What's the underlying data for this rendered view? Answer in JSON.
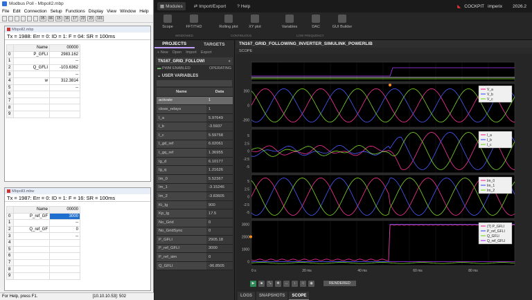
{
  "modbus": {
    "title": "Modbus Poll - Mbpoll2.mbp",
    "menu": [
      "File",
      "Edit",
      "Connection",
      "Setup",
      "Functions",
      "Display",
      "View",
      "Window",
      "Help"
    ],
    "toolbar": [
      "05",
      "06",
      "15",
      "16",
      "17",
      "22",
      "23",
      "101"
    ],
    "win1": {
      "title": "Mbpoll2.mbp",
      "status": "Tx = 1988: Err = 0: ID = 1: F = 04: SR = 100ms",
      "col_name": "Name",
      "col_value": "00000",
      "rows": [
        {
          "i": "0",
          "n": "P_GFLI",
          "v": "2983.162"
        },
        {
          "i": "1",
          "n": "",
          "v": "--"
        },
        {
          "i": "2",
          "n": "Q_GFLI",
          "v": "-103.6362"
        },
        {
          "i": "3",
          "n": "",
          "v": "--"
        },
        {
          "i": "4",
          "n": "w",
          "v": "312.3814"
        },
        {
          "i": "5",
          "n": "",
          "v": "--"
        },
        {
          "i": "6",
          "n": "",
          "v": ""
        },
        {
          "i": "7",
          "n": "",
          "v": ""
        },
        {
          "i": "8",
          "n": "",
          "v": ""
        },
        {
          "i": "9",
          "n": "",
          "v": ""
        }
      ]
    },
    "win2": {
      "title": "Mbpoll3.mbw",
      "status": "Tx = 1987: Err = 0: ID = 1: F = 16: SR = 100ms",
      "col_name": "Name",
      "col_value": "00000",
      "rows": [
        {
          "i": "0",
          "n": "P_ref_GF",
          "v": "3000"
        },
        {
          "i": "1",
          "n": "",
          "v": "--"
        },
        {
          "i": "2",
          "n": "Q_ref_GF",
          "v": "0"
        },
        {
          "i": "3",
          "n": "",
          "v": "--"
        },
        {
          "i": "4",
          "n": "",
          "v": ""
        },
        {
          "i": "5",
          "n": "",
          "v": ""
        },
        {
          "i": "6",
          "n": "",
          "v": ""
        },
        {
          "i": "7",
          "n": "",
          "v": ""
        },
        {
          "i": "8",
          "n": "",
          "v": ""
        },
        {
          "i": "9",
          "n": "",
          "v": ""
        }
      ]
    },
    "statusbar_left": "For Help, press F1.",
    "statusbar_right": "[10.10.10.53]: 502"
  },
  "cockpit": {
    "top_tabs": [
      "Modules",
      "Import/Export",
      "Help"
    ],
    "brand": "COCKPIT",
    "brand2": "imperix",
    "version": "2026.2",
    "ribbon": [
      "Scope",
      "FFT/THD",
      "Rolling plot",
      "XY plot",
      "Variables",
      "DAC",
      "GUI Builder"
    ],
    "ribbon_groups": [
      "WINDOWED",
      "CONTINUOUS",
      "LOW FREQUENCY"
    ],
    "left_tabs": [
      "PROJECTS",
      "TARGETS"
    ],
    "actions": [
      "+ New",
      "Open",
      "Import",
      "Export"
    ],
    "project_name": "TN167_GRID_FOLLOWI",
    "pwm_label": "PWM ENABLED",
    "pwm_status": "OPERATING",
    "user_vars_label": "USER VARIABLES",
    "col_name": "Name",
    "col_data": "Data",
    "variables": [
      {
        "n": "activate",
        "d": "1"
      },
      {
        "n": "close_relays",
        "d": "1"
      },
      {
        "n": "I_a",
        "d": "5.97649"
      },
      {
        "n": "I_b",
        "d": "-3.5937"
      },
      {
        "n": "I_c",
        "d": "5.59758"
      },
      {
        "n": "I_gd_ref",
        "d": "6.02061"
      },
      {
        "n": "I_gq_ref",
        "d": "1.36955"
      },
      {
        "n": "Ig_d",
        "d": "6.10177"
      },
      {
        "n": "Ig_q",
        "d": "1.21626"
      },
      {
        "n": "Im_0",
        "d": "5.52367"
      },
      {
        "n": "Im_1",
        "d": "-3.15246"
      },
      {
        "n": "Im_2",
        "d": "-3.83605"
      },
      {
        "n": "Ki_Ig",
        "d": "900"
      },
      {
        "n": "Kp_Ig",
        "d": "17.5"
      },
      {
        "n": "No_Grid",
        "d": "0"
      },
      {
        "n": "No_GridSync",
        "d": "0"
      },
      {
        "n": "P_GFLI",
        "d": "2905.18"
      },
      {
        "n": "P_ref_GFLI",
        "d": "3000"
      },
      {
        "n": "P_ref_sim",
        "d": "0"
      },
      {
        "n": "Q_GFLI",
        "d": "-96.8505"
      }
    ],
    "scope_title": "TN167_GRID_FOLLOWING_INVERTER_SIMULINK_POWERLIB",
    "scope_sub": "SCOPE",
    "rendered_label": "RENDERED",
    "bottom_tabs": [
      "LOGS",
      "SNAPSHOTS",
      "SCOPE"
    ],
    "colors": {
      "pink": "#ff3399",
      "blue": "#4a5cff",
      "green": "#7ddc2a",
      "purple": "#b23bff",
      "orange": "#ff8c1a"
    }
  },
  "chart_data": [
    {
      "type": "line",
      "series": [
        {
          "name": "",
          "values": [
            0,
            0,
            1,
            1
          ]
        }
      ]
    },
    {
      "type": "line",
      "ylabel": "",
      "ticks": [
        "200",
        "0",
        "-200"
      ],
      "ylim": [
        -300,
        300
      ],
      "series": [
        {
          "name": "V_a"
        },
        {
          "name": "V_b"
        },
        {
          "name": "V_c"
        }
      ],
      "amplitude": 230,
      "period_ms": 20
    },
    {
      "type": "line",
      "ticks": [
        "5",
        "2.5",
        "0",
        "-2.5",
        "-5"
      ],
      "ylim": [
        -7,
        7
      ],
      "series": [
        {
          "name": "I_a"
        },
        {
          "name": "I_b"
        },
        {
          "name": "I_c"
        }
      ],
      "step_at_ms": 50,
      "amplitude_before": 1,
      "amplitude_after": 6
    },
    {
      "type": "line",
      "ticks": [
        "5",
        "2.5",
        "0",
        "-2.5",
        "-5"
      ],
      "ylim": [
        -7,
        7
      ],
      "series": [
        {
          "name": "Im_0"
        },
        {
          "name": "Im_1"
        },
        {
          "name": "Im_2"
        }
      ],
      "amplitude": 6
    },
    {
      "type": "line",
      "ticks": [
        "3000",
        "2000",
        "1000",
        "0"
      ],
      "ylim": [
        -300,
        3300
      ],
      "x_ticks": [
        "0 s",
        "20 ms",
        "40 ms",
        "60 ms",
        "80 ms"
      ],
      "series": [
        {
          "name": "(T) P_GFLI"
        },
        {
          "name": "P_ref_GFLI"
        },
        {
          "name": "Q_GFLI"
        },
        {
          "name": "Q_ref_GFLI"
        }
      ],
      "step_at_ms": 50,
      "p_before": 150,
      "p_after": 2950
    }
  ]
}
